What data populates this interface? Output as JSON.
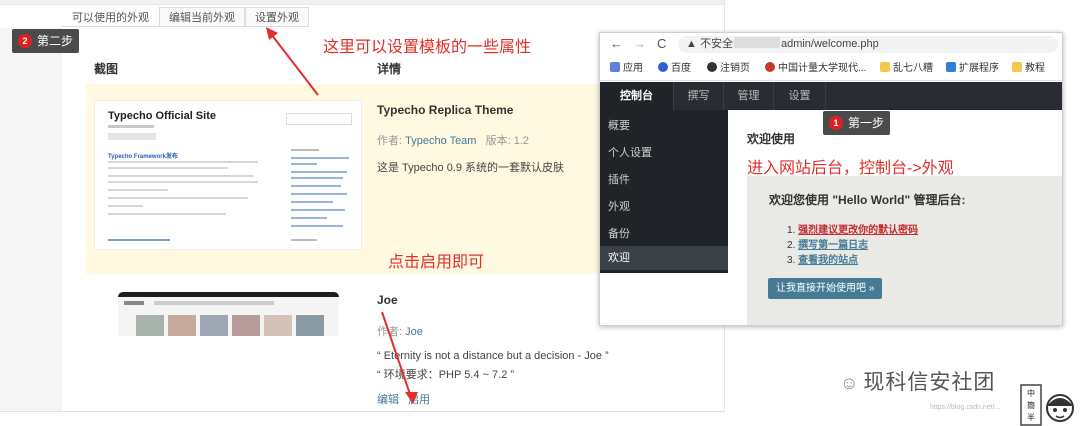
{
  "theme_page": {
    "tabs": [
      "可以使用的外观",
      "编辑当前外观",
      "设置外观"
    ],
    "step_label": "第二步",
    "step_number": "2",
    "col_screenshot": "截图",
    "col_details": "详情",
    "themes": [
      {
        "name": "Typecho Replica Theme",
        "author_label": "作者:",
        "author": "Typecho Team",
        "version": "版本: 1.2",
        "description": "这是 Typecho 0.9 系统的一套默认皮肤",
        "preview_title": "Typecho Official Site",
        "preview_link": "Typecho Framework发布"
      },
      {
        "name": "Joe",
        "author_label": "作者:",
        "author": "Joe",
        "description": "“ Eternity is not a distance but a decision - Joe ”",
        "requirement": "“ 环境要求：PHP 5.4 ~ 7.2 ”",
        "action_edit": "编辑",
        "action_enable": "启用"
      }
    ]
  },
  "annotations": {
    "set_attributes": "这里可以设置模板的一些属性",
    "click_enable": "点击启用即可",
    "enter_backend": "进入网站后台，控制台->外观"
  },
  "browser": {
    "nav_back": "←",
    "nav_forward": "→",
    "nav_reload": "C",
    "security_label": "不安全",
    "url_suffix": "admin/welcome.php",
    "bookmarks": [
      "应用",
      "百度",
      "注销页",
      "中国计量大学现代...",
      "乱七八糟",
      "扩展程序",
      "教程"
    ],
    "admin_tabs": [
      "控制台",
      "撰写",
      "管理",
      "设置"
    ],
    "menu_items": [
      "概要",
      "个人设置",
      "插件",
      "外观",
      "备份",
      "欢迎"
    ],
    "step_label": "第一步",
    "step_number": "1",
    "welcome_title": "欢迎使用",
    "welcome_heading": "欢迎您使用 \"Hello World\" 管理后台:",
    "welcome_links": [
      "强烈建议更改你的默认密码",
      "撰写第一篇日志",
      "查看我的站点"
    ],
    "start_button": "让我直接开始使用吧 »"
  },
  "watermark": {
    "wechat_name": "现科信安社团",
    "blog_url": "https://blog.csdn.net/...",
    "mascot_text": "中 簡 半"
  },
  "colors": {
    "annotation_red": "#e0302c",
    "admin_dark": "#292d33",
    "link_blue": "#467b96",
    "highlight_row": "#fff9e1"
  }
}
